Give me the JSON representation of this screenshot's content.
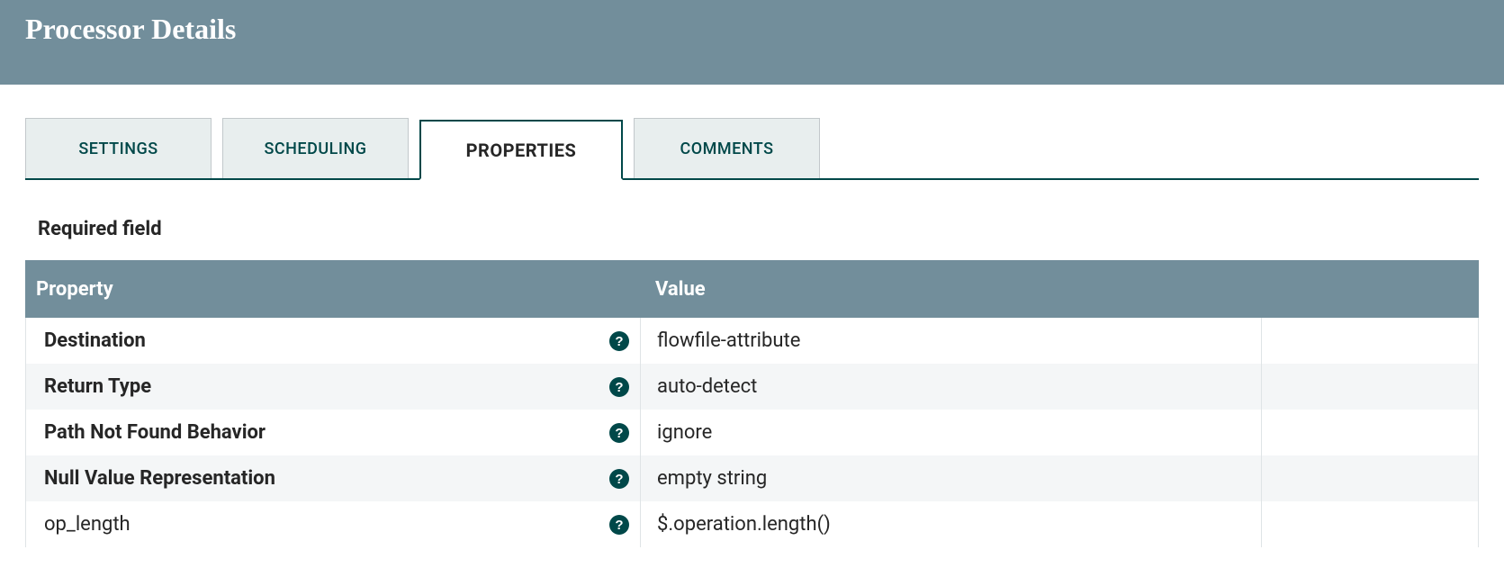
{
  "header": {
    "title": "Processor Details"
  },
  "tabs": {
    "settings": {
      "label": "SETTINGS"
    },
    "scheduling": {
      "label": "SCHEDULING"
    },
    "properties": {
      "label": "PROPERTIES"
    },
    "comments": {
      "label": "COMMENTS"
    }
  },
  "required_label": "Required field",
  "table": {
    "head": {
      "property": "Property",
      "value": "Value"
    },
    "rows": [
      {
        "name": "Destination",
        "bold": true,
        "value": "flowfile-attribute"
      },
      {
        "name": "Return Type",
        "bold": true,
        "value": "auto-detect"
      },
      {
        "name": "Path Not Found Behavior",
        "bold": true,
        "value": "ignore"
      },
      {
        "name": "Null Value Representation",
        "bold": true,
        "value": "empty string"
      },
      {
        "name": "op_length",
        "bold": false,
        "value": "$.operation.length()"
      }
    ]
  }
}
